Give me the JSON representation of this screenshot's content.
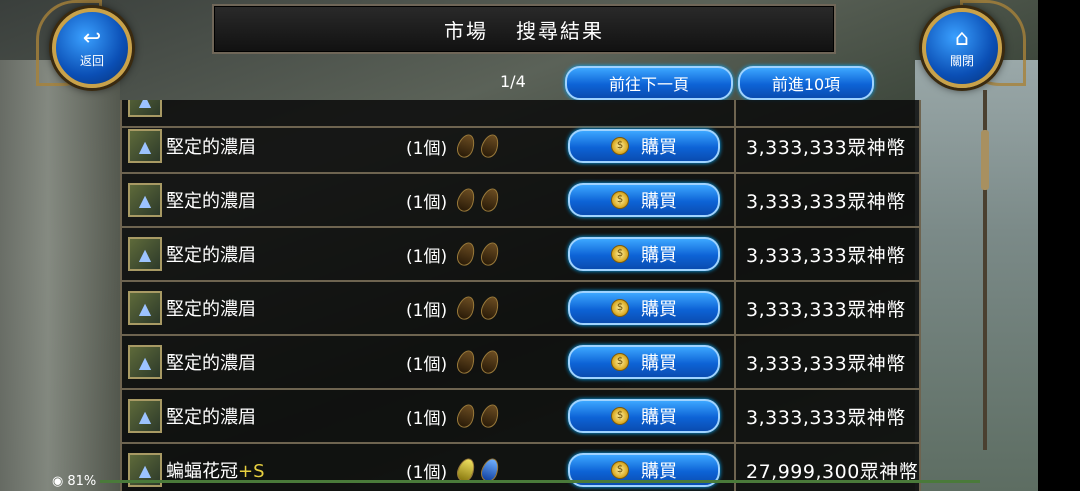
{
  "header": {
    "title": "市場",
    "subtitle": "搜尋結果"
  },
  "nav": {
    "back_label": "返回",
    "close_label": "關閉",
    "back_icon": "undo-arrow-icon",
    "close_icon": "home-icon"
  },
  "pager": {
    "page_indicator": "1/4",
    "next_page_label": "前往下一頁",
    "next_10_label": "前進10項"
  },
  "listing": {
    "buy_label": "購買",
    "rows": [
      {
        "name": "堅定的濃眉",
        "quantity": "(1個)",
        "price": "3,333,333眾神幣",
        "icon": "wizard-hat-icon"
      },
      {
        "name": "堅定的濃眉",
        "quantity": "(1個)",
        "price": "3,333,333眾神幣",
        "icon": "wizard-hat-icon"
      },
      {
        "name": "堅定的濃眉",
        "quantity": "(1個)",
        "price": "3,333,333眾神幣",
        "icon": "wizard-hat-icon"
      },
      {
        "name": "堅定的濃眉",
        "quantity": "(1個)",
        "price": "3,333,333眾神幣",
        "icon": "wizard-hat-icon"
      },
      {
        "name": "堅定的濃眉",
        "quantity": "(1個)",
        "price": "3,333,333眾神幣",
        "icon": "wizard-hat-icon"
      },
      {
        "name": "堅定的濃眉",
        "quantity": "(1個)",
        "price": "3,333,333眾神幣",
        "icon": "wizard-hat-icon"
      },
      {
        "name": "蝙蝠花冠",
        "name_suffix": "+S",
        "quantity": "(1個)",
        "price": "27,999,300眾神幣",
        "icon": "wizard-hat-icon"
      }
    ]
  },
  "status": {
    "battery": "81%"
  },
  "colors": {
    "accent": "#0d63d6",
    "border": "#6e6450",
    "gold": "#c9a24a"
  }
}
